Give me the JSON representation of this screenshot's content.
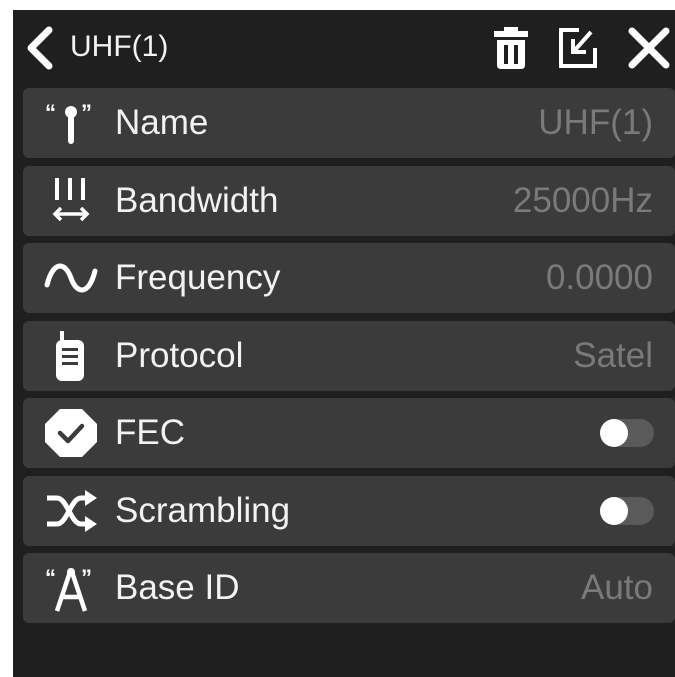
{
  "header": {
    "title": "UHF(1)",
    "back_icon": "chevron-left-icon",
    "delete_icon": "trash-icon",
    "edit_icon": "edit-export-icon",
    "close_icon": "close-icon"
  },
  "rows": [
    {
      "icon": "antenna-icon",
      "label": "Name",
      "value": "UHF(1)"
    },
    {
      "icon": "bandwidth-icon",
      "label": "Bandwidth",
      "value": "25000Hz"
    },
    {
      "icon": "wave-icon",
      "label": "Frequency",
      "value": "0.0000"
    },
    {
      "icon": "radio-device-icon",
      "label": "Protocol",
      "value": "Satel"
    },
    {
      "icon": "check-badge-icon",
      "label": "FEC",
      "toggle": false
    },
    {
      "icon": "shuffle-icon",
      "label": "Scrambling",
      "toggle": false
    },
    {
      "icon": "tower-icon",
      "label": "Base ID",
      "value": "Auto"
    }
  ],
  "colors": {
    "background": "#1f1f1f",
    "row": "#3b3b3b",
    "text": "#f2f2f2",
    "value": "#7a7a7a"
  }
}
